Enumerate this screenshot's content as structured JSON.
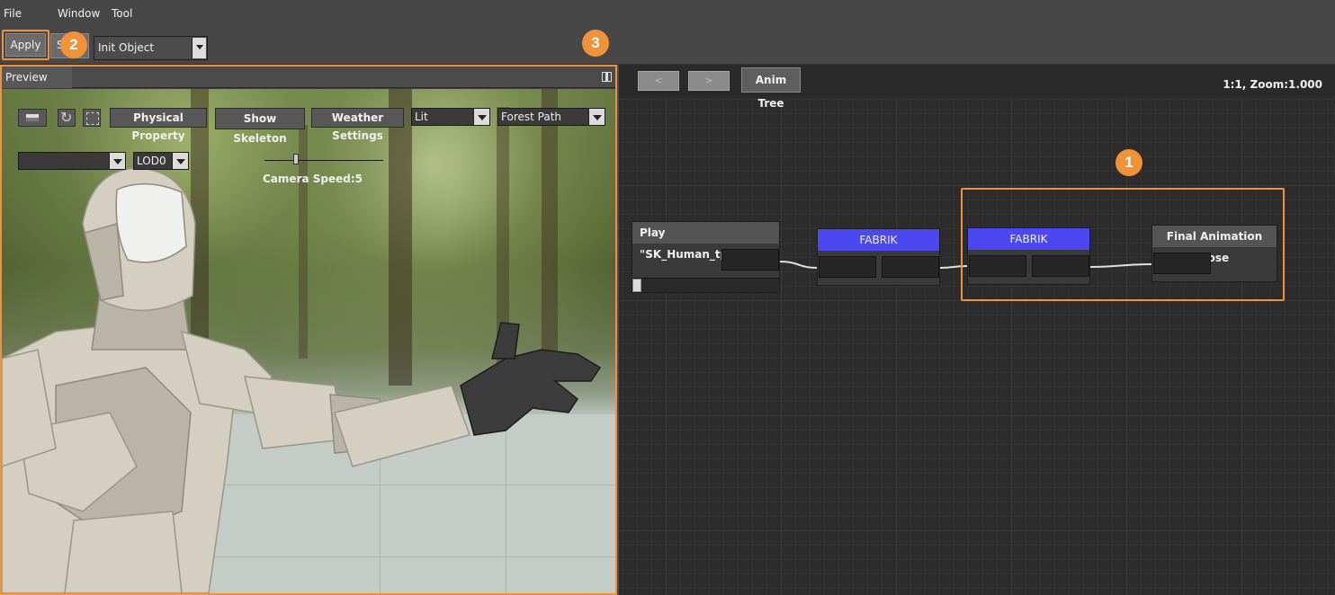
{
  "menu": {
    "file": "File",
    "window": "Window",
    "tool": "Tool"
  },
  "toolbar": {
    "apply_label": "Apply",
    "second_button_label": "S",
    "object_select_value": "Init Object"
  },
  "badges": {
    "one": "1",
    "two": "2",
    "three": "3"
  },
  "accent_color": "#f0923a",
  "preview": {
    "tab_label": "Preview",
    "buttons": {
      "physical_property": "Physical Property",
      "show_skeleton": "Show Skeleton",
      "weather_settings": "Weather Settings"
    },
    "lighting_mode": "Lit",
    "environment": "Forest Path",
    "animation_select": "",
    "lod": "LOD0",
    "camera_speed_label": "Camera Speed:5",
    "camera_speed": 5
  },
  "graph": {
    "back_label": "<",
    "forward_label": ">",
    "anim_tree_label": "Anim Tree",
    "zoom_label": "1:1, Zoom:1.000",
    "nodes": [
      {
        "title": "Play \"SK_Human_tpose\"",
        "color": "#545454"
      },
      {
        "title": "FABRIK",
        "color": "#4b48f2"
      },
      {
        "title": "FABRIK",
        "color": "#4b48f2"
      },
      {
        "title": "Final Animation Pose",
        "color": "#545454"
      }
    ]
  }
}
